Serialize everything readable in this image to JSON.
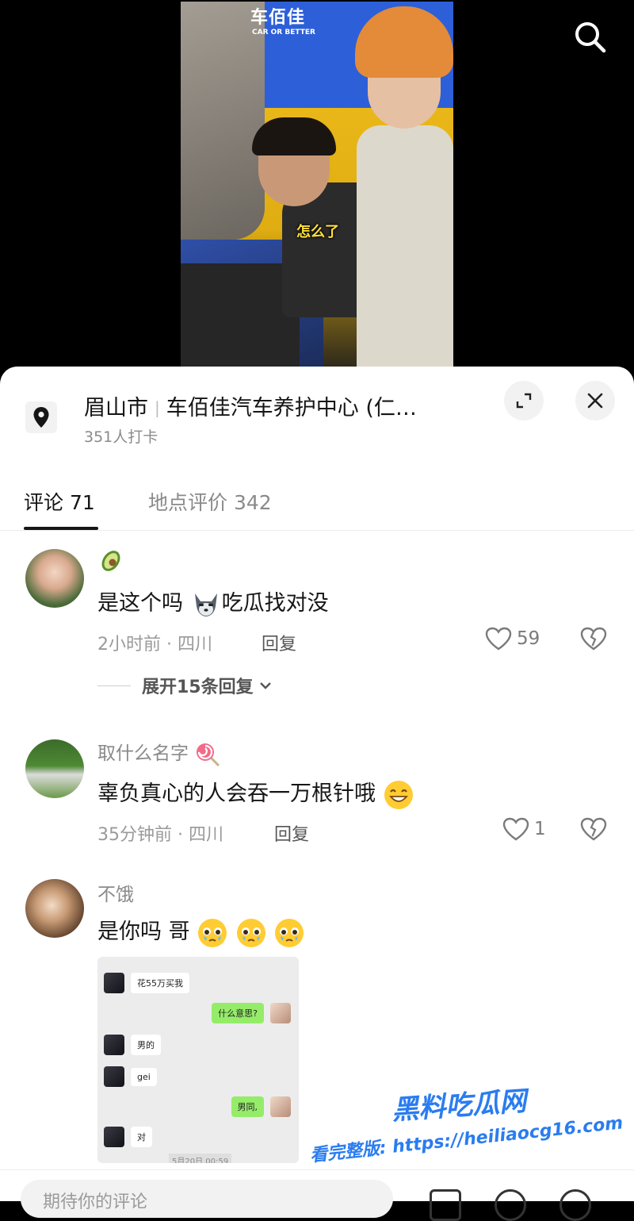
{
  "video": {
    "sign_text": "车佰佳",
    "sign_sub": "CAR OR BETTER",
    "caption": "怎么了"
  },
  "location": {
    "city": "眉山市",
    "place": "车佰佳汽车养护中心 (仁…",
    "checkins": "351人打卡"
  },
  "tabs": [
    {
      "label": "评论 71",
      "active": true
    },
    {
      "label": "地点评价 342",
      "active": false
    }
  ],
  "comments": [
    {
      "username": "",
      "username_emoji": "avocado",
      "text": "是这个吗",
      "text_suffix": "吃瓜找对没",
      "time": "2小时前 · 四川",
      "reply": "回复",
      "likes": "59",
      "expand": "展开15条回复"
    },
    {
      "username": "取什么名字",
      "username_emoji": "lollipop",
      "text": "辜负真心的人会吞一万根针哦",
      "time": "35分钟前 · 四川",
      "reply": "回复",
      "likes": "1"
    },
    {
      "username": "不饿",
      "text": "是你吗 哥",
      "image_chat": {
        "msgs": [
          {
            "side": "left",
            "text": "花55万买我"
          },
          {
            "side": "right",
            "text": "什么意思?"
          },
          {
            "side": "left",
            "text": "男的"
          },
          {
            "side": "left",
            "text": "gei"
          },
          {
            "side": "right",
            "text": "男同,"
          },
          {
            "side": "left",
            "text": "对"
          }
        ],
        "time": "5月20日 00:59"
      }
    }
  ],
  "watermark": {
    "title": "黑料吃瓜网",
    "url": "看完整版: https://heiliaocg16.com"
  },
  "input": {
    "placeholder": "期待你的评论"
  },
  "colors": {
    "accent": "#161616",
    "watermark": "#2a7cf0",
    "chat_green": "#95ec69"
  }
}
